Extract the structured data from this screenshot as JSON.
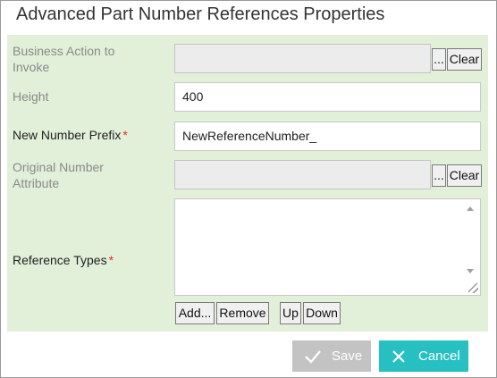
{
  "dialog": {
    "title": "Advanced Part Number References Properties"
  },
  "form": {
    "business_action": {
      "label": "Business Action to Invoke",
      "label_line1": "Business Action to",
      "label_line2": "Invoke",
      "value": "",
      "browse_label": "...",
      "clear_label": "Clear",
      "enabled": false
    },
    "height": {
      "label": "Height",
      "value": "400",
      "enabled": false
    },
    "new_number_prefix": {
      "label": "New Number Prefix",
      "required_marker": "*",
      "value": "NewReferenceNumber_",
      "enabled": true
    },
    "original_number_attribute": {
      "label": "Original Number Attribute",
      "label_line1": "Original Number",
      "label_line2": "Attribute",
      "value": "",
      "browse_label": "...",
      "clear_label": "Clear",
      "enabled": false
    },
    "reference_types": {
      "label": "Reference Types",
      "required_marker": "*",
      "items": [],
      "buttons": {
        "add": "Add...",
        "remove": "Remove",
        "up": "Up",
        "down": "Down"
      }
    }
  },
  "footer": {
    "save_label": "Save",
    "save_icon": "checkmark-icon",
    "save_enabled": false,
    "cancel_label": "Cancel",
    "cancel_icon": "close-icon",
    "colors": {
      "save_disabled_bg": "#c3c3c3",
      "cancel_bg": "#26bfc2",
      "form_bg": "#e2efd9",
      "required": "#e0301e"
    }
  }
}
